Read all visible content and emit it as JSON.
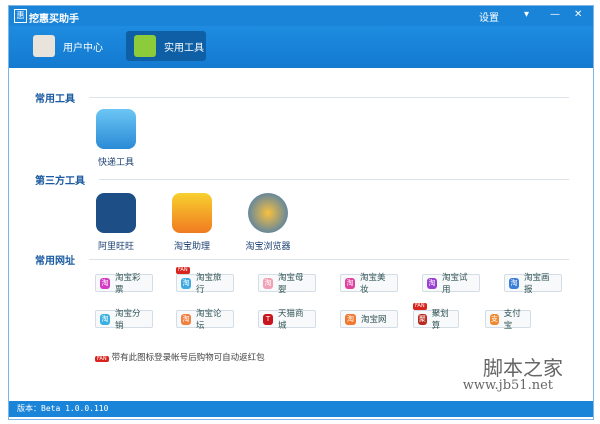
{
  "title": "挖惠买助手",
  "title_controls": {
    "settings": "设置",
    "dropdown": "▾",
    "minimize": "—",
    "close": "✕"
  },
  "tabs": [
    {
      "label": "用户中心"
    },
    {
      "label": "实用工具"
    }
  ],
  "sections": {
    "common_tools": "常用工具",
    "third_party": "第三方工具",
    "common_sites": "常用网址"
  },
  "common_tools": [
    {
      "label": "快递工具"
    }
  ],
  "third_party_tools": [
    {
      "label": "阿里旺旺"
    },
    {
      "label": "淘宝助理"
    },
    {
      "label": "淘宝浏览器"
    }
  ],
  "sites": [
    {
      "label": "淘宝彩票",
      "color": "#d43bc4",
      "icon": "淘"
    },
    {
      "label": "淘宝旅行",
      "color": "#3fa9e0",
      "icon": "淘",
      "badge": "FAN"
    },
    {
      "label": "淘宝母婴",
      "color": "#f2a0b5",
      "icon": "淘"
    },
    {
      "label": "淘宝美妆",
      "color": "#e040a0",
      "icon": "淘"
    },
    {
      "label": "淘宝试用",
      "color": "#9a40d0",
      "icon": "淘"
    },
    {
      "label": "淘宝画报",
      "color": "#3a7fd8",
      "icon": "淘"
    },
    {
      "label": "淘宝分销",
      "color": "#3ab0e0",
      "icon": "淘"
    },
    {
      "label": "淘宝论坛",
      "color": "#f08040",
      "icon": "淘"
    },
    {
      "label": "天猫商城",
      "color": "#c8141c",
      "icon": "T"
    },
    {
      "label": "淘宝网",
      "color": "#f07830",
      "icon": "淘"
    },
    {
      "label": "聚划算",
      "color": "#b82a20",
      "icon": "聚",
      "badge": "FAN"
    },
    {
      "label": "支付宝",
      "color": "#f08a30",
      "icon": "支"
    }
  ],
  "note": {
    "badge": "FAN",
    "text": "带有此图标登录帐号后购物可自动返红包"
  },
  "status": "版本：Beta 1.0.0.110",
  "watermark": {
    "line1": "脚本之家",
    "line2": "www.jb51.net"
  }
}
